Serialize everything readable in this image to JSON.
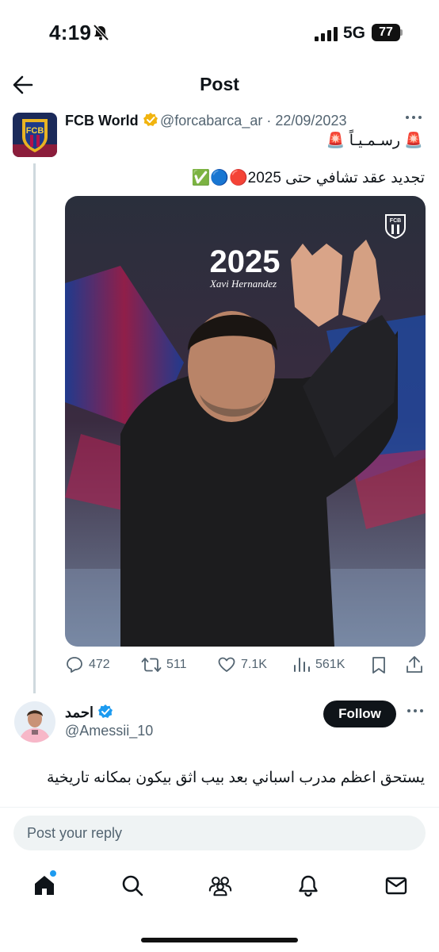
{
  "status_bar": {
    "time": "4:19",
    "network": "5G",
    "battery": "77"
  },
  "header": {
    "title": "Post"
  },
  "post": {
    "author_name": "FCB World",
    "handle": "@forcabarca_ar",
    "separator": "·",
    "date": "22/09/2023",
    "line1": "🚨 رسـمـيـاً 🚨",
    "line2": "تجديد عقد تشافي حتى 2025🔴🔵✅",
    "image": {
      "year": "2025",
      "caption": "Xavi Hernandez",
      "badge": "FCB"
    },
    "avatar_text": "FCB",
    "stats": {
      "replies": "472",
      "reposts": "511",
      "likes": "7.1K",
      "views": "561K"
    }
  },
  "reply": {
    "author_name": "احمد",
    "handle": "@Amessii_10",
    "follow_label": "Follow",
    "text": "يستحق اعظم مدرب اسباني بعد بيب اثق بيكون بمكانه تاريخية"
  },
  "composer": {
    "placeholder": "Post your reply"
  },
  "colors": {
    "accent": "#1d9bf0",
    "verified": "#f1b40f",
    "text": "#0f1419",
    "muted": "#536471"
  }
}
